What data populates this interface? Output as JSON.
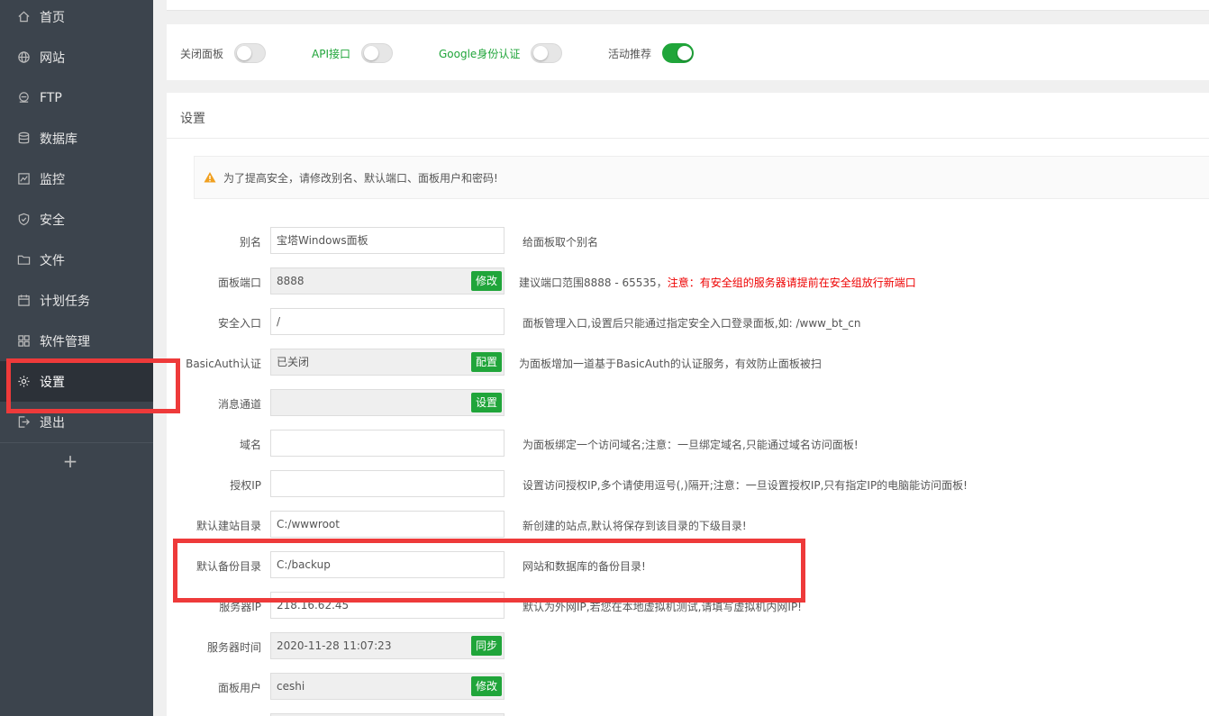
{
  "sidebar": {
    "items": [
      {
        "label": "首页",
        "icon": "home-icon"
      },
      {
        "label": "网站",
        "icon": "globe-icon"
      },
      {
        "label": "FTP",
        "icon": "ftp-icon"
      },
      {
        "label": "数据库",
        "icon": "database-icon"
      },
      {
        "label": "监控",
        "icon": "monitor-icon"
      },
      {
        "label": "安全",
        "icon": "shield-icon"
      },
      {
        "label": "文件",
        "icon": "folder-icon"
      },
      {
        "label": "计划任务",
        "icon": "calendar-icon"
      },
      {
        "label": "软件管理",
        "icon": "apps-icon"
      },
      {
        "label": "设置",
        "icon": "gear-icon"
      },
      {
        "label": "退出",
        "icon": "logout-icon"
      }
    ],
    "add_label": "+"
  },
  "toggles": [
    {
      "label": "关闭面板",
      "on": false,
      "color": "normal"
    },
    {
      "label": "API接口",
      "on": false,
      "color": "green"
    },
    {
      "label": "Google身份认证",
      "on": false,
      "color": "green"
    },
    {
      "label": "活动推荐",
      "on": true,
      "color": "normal"
    }
  ],
  "settings": {
    "title": "设置",
    "warning": "为了提高安全，请修改别名、默认端口、面板用户和密码!",
    "rows": [
      {
        "label": "别名",
        "value": "宝塔Windows面板",
        "hint": "给面板取个别名",
        "button": ""
      },
      {
        "label": "面板端口",
        "value": "8888",
        "hint": "建议端口范围8888 - 65535，",
        "hint_red": "注意：有安全组的服务器请提前在安全组放行新端口",
        "button": "修改"
      },
      {
        "label": "安全入口",
        "value": "/",
        "hint": "面板管理入口,设置后只能通过指定安全入口登录面板,如: /www_bt_cn",
        "button": ""
      },
      {
        "label": "BasicAuth认证",
        "value": "已关闭",
        "hint": "为面板增加一道基于BasicAuth的认证服务，有效防止面板被扫",
        "button": "配置"
      },
      {
        "label": "消息通道",
        "value": "",
        "hint": "",
        "button": "设置"
      },
      {
        "label": "域名",
        "value": "",
        "hint": "为面板绑定一个访问域名;注意：一旦绑定域名,只能通过域名访问面板!",
        "button": ""
      },
      {
        "label": "授权IP",
        "value": "",
        "hint": "设置访问授权IP,多个请使用逗号(,)隔开;注意：一旦设置授权IP,只有指定IP的电脑能访问面板!",
        "button": ""
      },
      {
        "label": "默认建站目录",
        "value": "C:/wwwroot",
        "hint": "新创建的站点,默认将保存到该目录的下级目录!",
        "button": ""
      },
      {
        "label": "默认备份目录",
        "value": "C:/backup",
        "hint": "网站和数据库的备份目录!",
        "button": ""
      },
      {
        "label": "服务器IP",
        "value": "218.16.62.45",
        "hint": "默认为外网IP,若您在本地虚拟机测试,请填写虚拟机内网IP!",
        "button": ""
      },
      {
        "label": "服务器时间",
        "value": "2020-11-28 11:07:23",
        "hint": "",
        "button": "同步"
      },
      {
        "label": "面板用户",
        "value": "ceshi",
        "hint": "",
        "button": "修改"
      }
    ]
  },
  "colors": {
    "accent_green": "#20a53a",
    "highlight_red": "#ee3a3a",
    "sidebar_bg": "#3c444d"
  }
}
